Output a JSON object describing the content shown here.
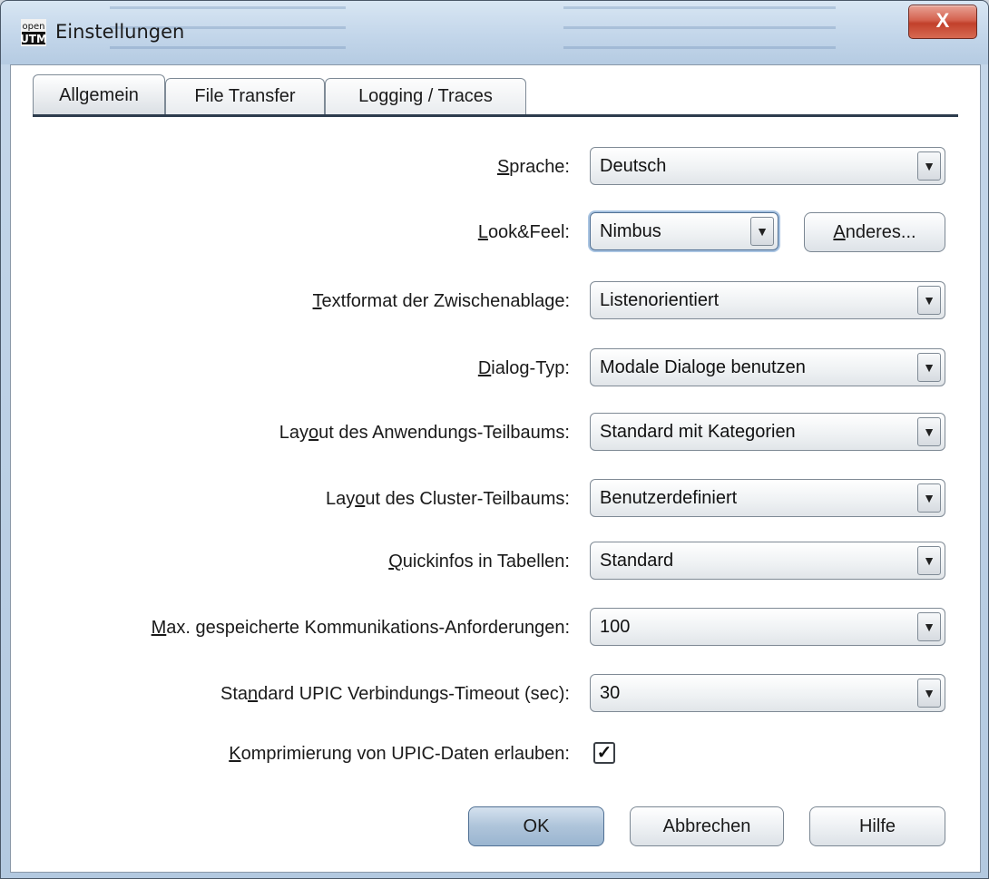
{
  "window": {
    "title": "Einstellungen",
    "icon_text_top": "open",
    "icon_text_bottom": "UTM",
    "close_glyph": "X"
  },
  "tabs": [
    {
      "label": "Allgemein",
      "active": true
    },
    {
      "label": "File Transfer",
      "active": false
    },
    {
      "label": "Logging / Traces",
      "active": false
    }
  ],
  "settings": {
    "sprache": {
      "label_pre": "",
      "label_u": "S",
      "label_post": "prache:",
      "value": "Deutsch"
    },
    "lookfeel": {
      "label_pre": "",
      "label_u": "L",
      "label_post": "ook&Feel:",
      "value": "Nimbus",
      "button_pre": "",
      "button_u": "A",
      "button_post": "nderes..."
    },
    "textformat": {
      "label_pre": "",
      "label_u": "T",
      "label_post": "extformat der Zwischenablage:",
      "value": "Listenorientiert"
    },
    "dialogtyp": {
      "label_pre": "",
      "label_u": "D",
      "label_post": "ialog-Typ:",
      "value": "Modale Dialoge benutzen"
    },
    "anwendung": {
      "label_pre": "Lay",
      "label_u": "o",
      "label_post": "ut des Anwendungs-Teilbaums:",
      "value": "Standard mit Kategorien"
    },
    "cluster": {
      "label_pre": "Lay",
      "label_u": "o",
      "label_post": "ut des Cluster-Teilbaums:",
      "value": "Benutzerdefiniert"
    },
    "quickinfos": {
      "label_pre": "",
      "label_u": "Q",
      "label_post": "uickinfos in Tabellen:",
      "value": "Standard"
    },
    "maxanf": {
      "label_pre": "",
      "label_u": "M",
      "label_post": "ax. gespeicherte Kommunikations-Anforderungen:",
      "value": "100"
    },
    "timeout": {
      "label_pre": "Sta",
      "label_u": "n",
      "label_post": "dard UPIC Verbindungs-Timeout (sec):",
      "value": "30"
    },
    "komprimierung": {
      "label_pre": "",
      "label_u": "K",
      "label_post": "omprimierung von UPIC-Daten erlauben:",
      "checked": true,
      "check_glyph": "✓"
    }
  },
  "buttons": {
    "ok": "OK",
    "cancel": "Abbrechen",
    "help": "Hilfe"
  },
  "icons": {
    "dropdown_arrow": "▼"
  }
}
